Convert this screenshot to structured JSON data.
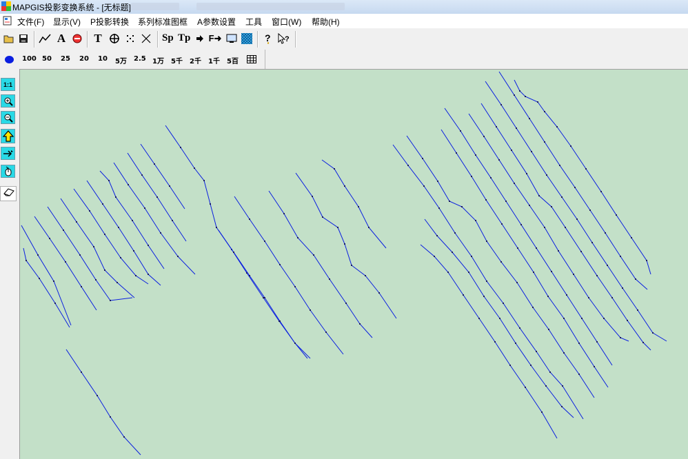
{
  "window": {
    "title": "MAPGIS投影变换系统 - [无标题]"
  },
  "menu": [
    "文件(F)",
    "显示(V)",
    "P投影转换",
    "系列标准图框",
    "A参数设置",
    "工具",
    "窗口(W)",
    "帮助(H)"
  ],
  "toolbar": {
    "buttons": [
      "open-folder-icon",
      "save-icon",
      "polyline-icon",
      "text-A-icon",
      "no-entry-icon",
      "text-T-icon",
      "crosshair-icon",
      "points-icon",
      "delete-x-icon",
      "sp-button",
      "tp-button",
      "arrow-right-icon",
      "f-arrow-icon",
      "monitor-icon",
      "grid-map-icon",
      "help-icon",
      "context-help-icon"
    ],
    "sp_label": "Sp",
    "tp_label": "Tp"
  },
  "scale_bar": {
    "dot_color": "#0a1ee0",
    "scales": [
      "100",
      "50",
      "25",
      "20",
      "10",
      "5万",
      "2.5",
      "1万",
      "5千",
      "2千",
      "1千",
      "5百"
    ]
  },
  "left_tools": {
    "one_to_one": "1:1",
    "buttons": [
      "zoom-to-1-1-button",
      "zoom-in-icon",
      "zoom-out-icon",
      "move-up-icon",
      "pan-icon",
      "refresh-icon",
      "eraser-icon"
    ]
  },
  "map": {
    "background": "#c3e0c8",
    "line_color": "#0a1ee0"
  }
}
